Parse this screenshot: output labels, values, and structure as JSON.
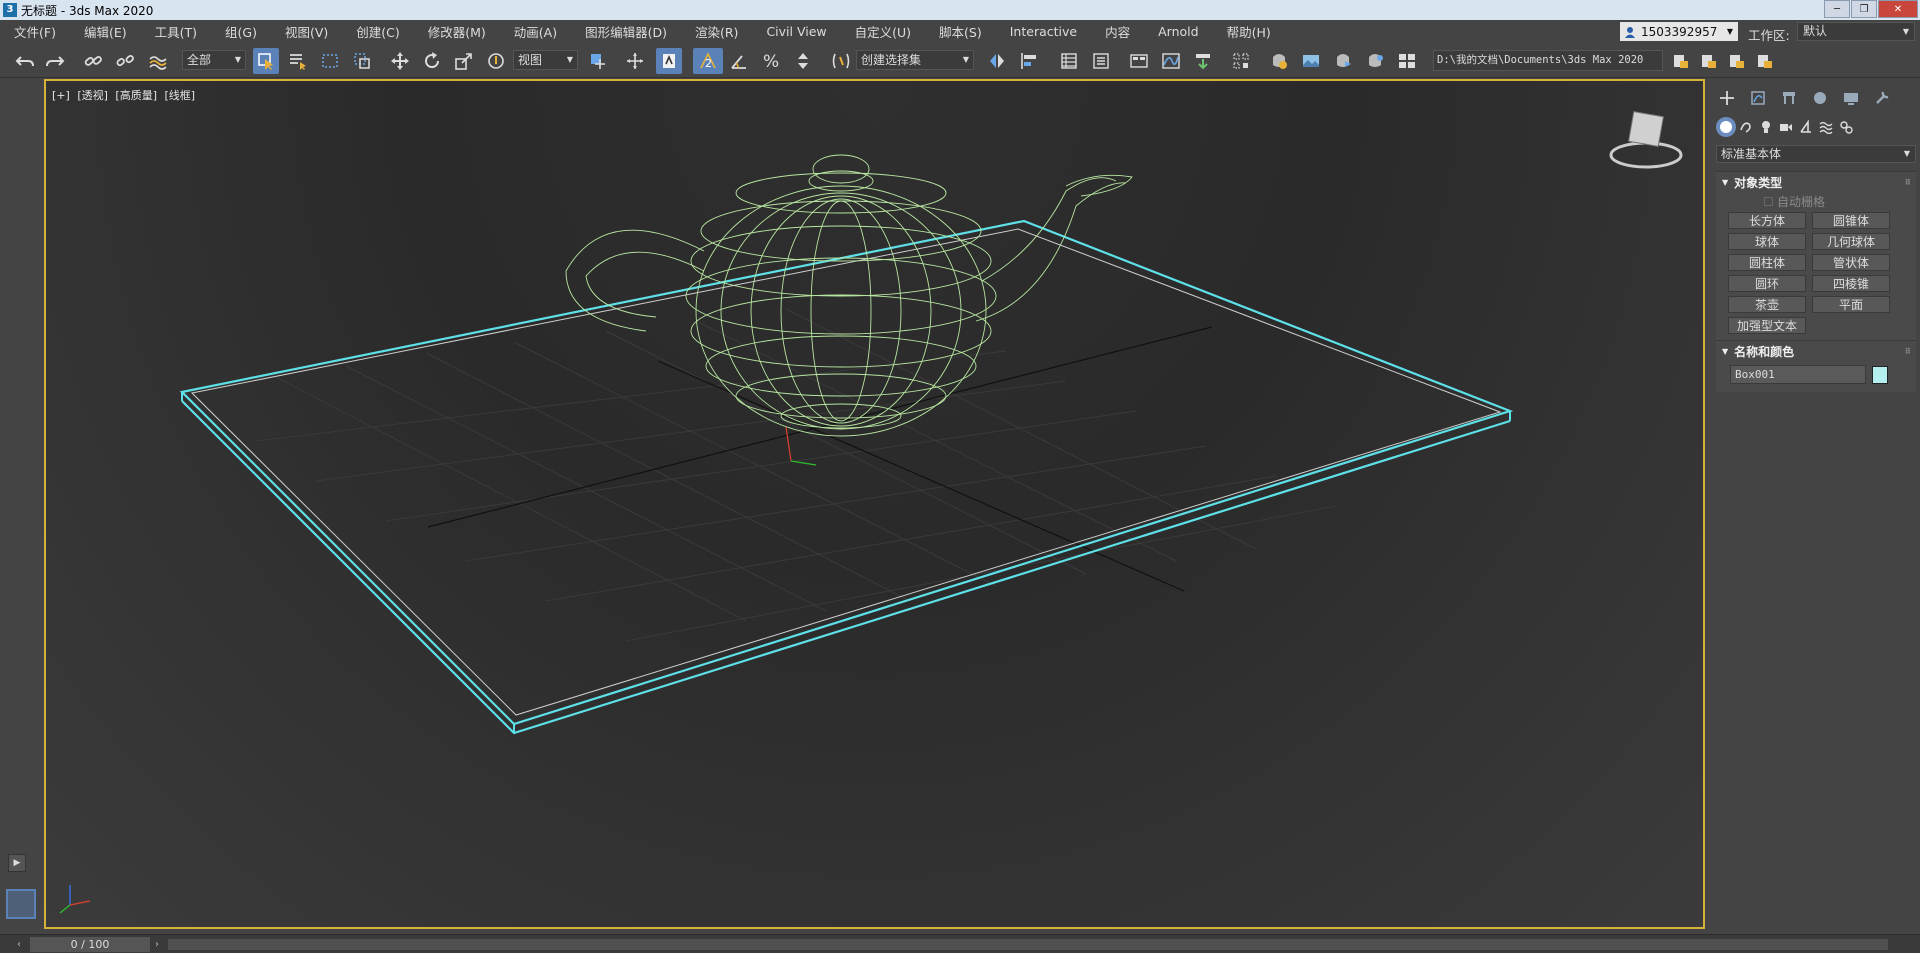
{
  "window": {
    "app_icon": "3",
    "title": "无标题 - 3ds Max 2020",
    "minimize_glyph": "─",
    "maximize_glyph": "❐",
    "close_glyph": "✕"
  },
  "menu": [
    "文件(F)",
    "编辑(E)",
    "工具(T)",
    "组(G)",
    "视图(V)",
    "创建(C)",
    "修改器(M)",
    "动画(A)",
    "图形编辑器(D)",
    "渲染(R)",
    "Civil View",
    "自定义(U)",
    "脚本(S)",
    "Interactive",
    "内容",
    "Arnold",
    "帮助(H)"
  ],
  "account": {
    "user": "1503392957"
  },
  "workspace": {
    "label": "工作区:",
    "value": "默认"
  },
  "toolbar": {
    "selection_filter": "全部",
    "reference_coord": "视图",
    "snap_label": "2",
    "named_selection": "创建选择集",
    "project_path": "D:\\我的文档\\Documents\\3ds Max 2020"
  },
  "viewport": {
    "labels": [
      "[+]",
      "[透视]",
      "[高质量]",
      "[线框]"
    ]
  },
  "command_panel": {
    "category": "标准基本体",
    "object_type_header": "对象类型",
    "auto_grid": "自动栅格",
    "object_buttons": [
      "长方体",
      "圆锥体",
      "球体",
      "几何球体",
      "圆柱体",
      "管状体",
      "圆环",
      "四棱锥",
      "茶壶",
      "平面",
      "加强型文本"
    ],
    "name_color_header": "名称和颜色",
    "object_name": "Box001",
    "object_color": "#b4f0f0"
  },
  "timeline": {
    "frame": "0 / 100"
  },
  "colors": {
    "teapot_wire": "#b8e6a0",
    "selection_box": "#5ee0e8",
    "viewport_border": "#d7b23a"
  }
}
